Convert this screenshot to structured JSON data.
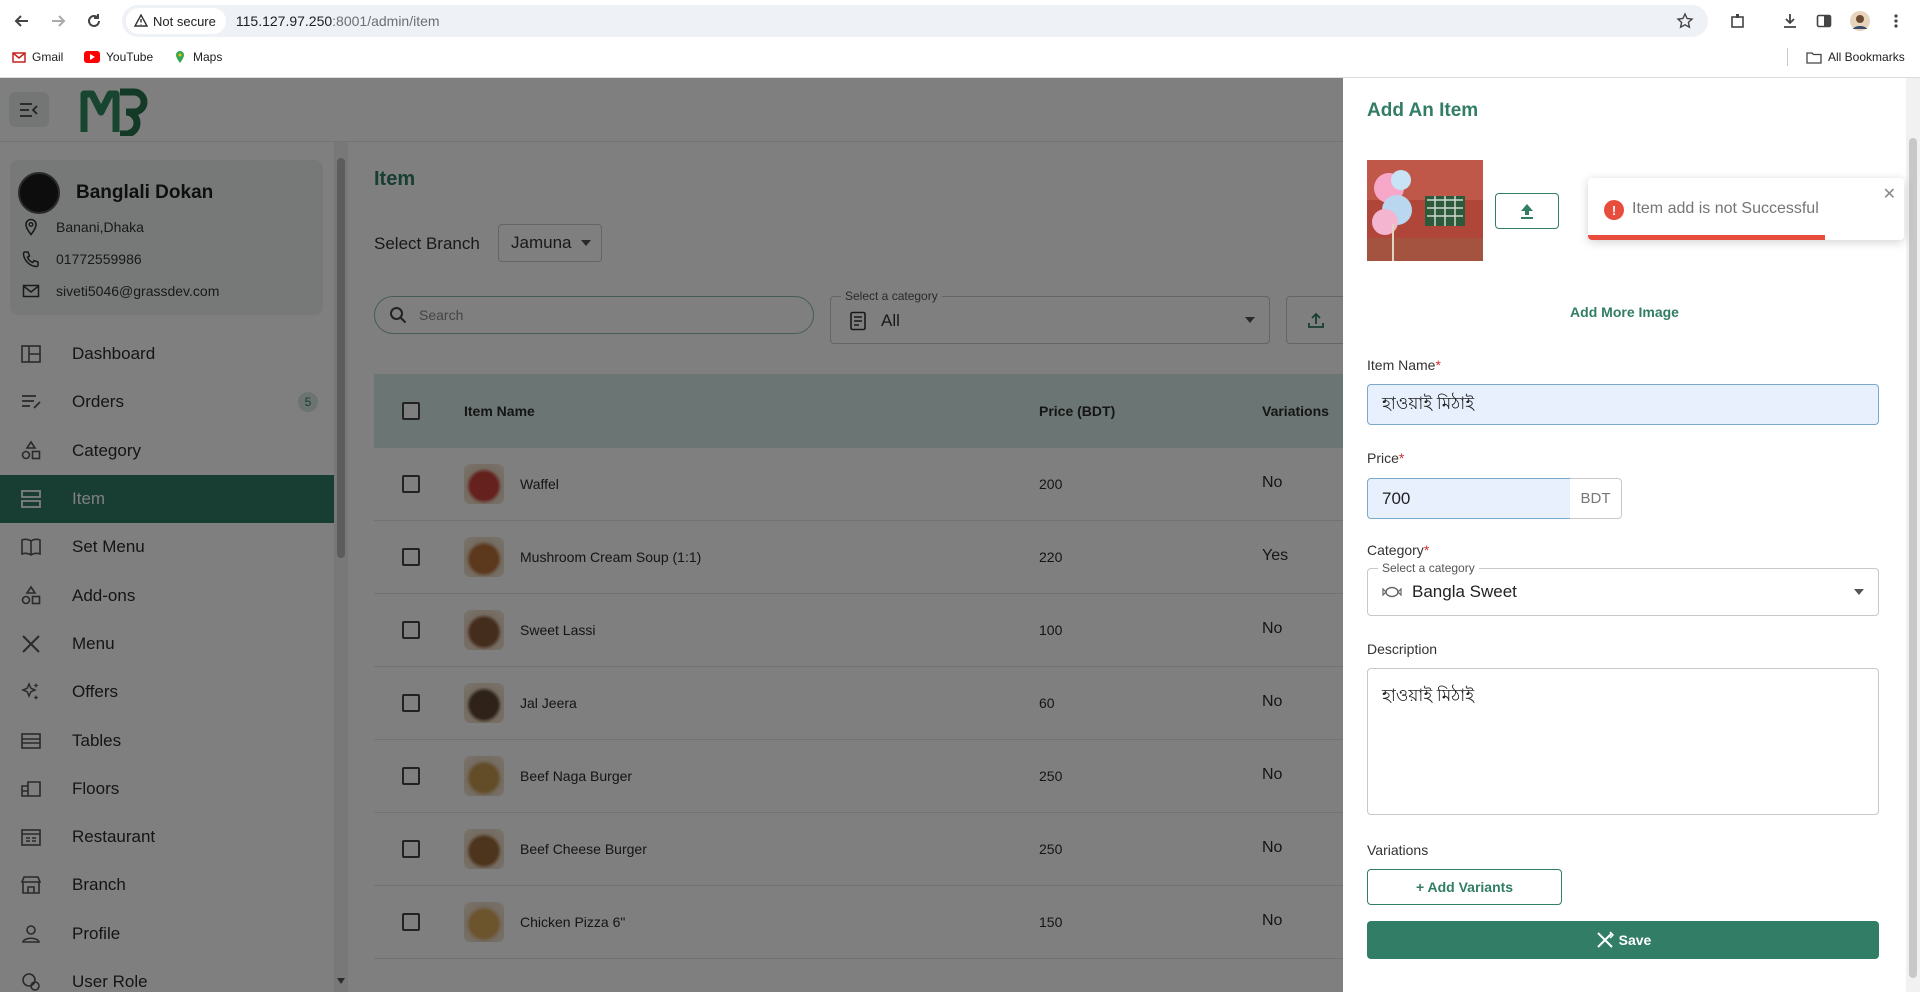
{
  "browser": {
    "security_label": "Not secure",
    "url_host": "115.127.97.250",
    "url_rest": ":8001/admin/item",
    "bookmarks": [
      "Gmail",
      "YouTube",
      "Maps"
    ],
    "all_bookmarks": "All Bookmarks"
  },
  "sidebar": {
    "shop_name": "Banglali Dokan",
    "address": "Banani,Dhaka",
    "phone": "01772559986",
    "email": "siveti5046@grassdev.com",
    "items": [
      {
        "label": "Dashboard",
        "icon": "dashboard-icon"
      },
      {
        "label": "Orders",
        "icon": "orders-icon",
        "badge": "5"
      },
      {
        "label": "Category",
        "icon": "category-icon"
      },
      {
        "label": "Item",
        "icon": "item-icon",
        "active": true
      },
      {
        "label": "Set Menu",
        "icon": "set-menu-icon"
      },
      {
        "label": "Add-ons",
        "icon": "add-ons-icon"
      },
      {
        "label": "Menu",
        "icon": "menu-icon"
      },
      {
        "label": "Offers",
        "icon": "offers-icon"
      },
      {
        "label": "Tables",
        "icon": "tables-icon"
      },
      {
        "label": "Floors",
        "icon": "floors-icon"
      },
      {
        "label": "Restaurant",
        "icon": "restaurant-icon"
      },
      {
        "label": "Branch",
        "icon": "branch-icon"
      },
      {
        "label": "Profile",
        "icon": "profile-icon"
      },
      {
        "label": "User Role",
        "icon": "user-role-icon"
      }
    ]
  },
  "main": {
    "title": "Item",
    "branch_label": "Select Branch",
    "branch_value": "Jamuna",
    "search_placeholder": "Search",
    "category_legend": "Select a category",
    "category_value": "All",
    "table": {
      "columns": [
        "Item Name",
        "Price (BDT)",
        "Variations"
      ],
      "rows": [
        {
          "name": "Waffel",
          "price": "200",
          "variations": "No",
          "thumb": "#c9423a"
        },
        {
          "name": "Mushroom Cream Soup (1:1)",
          "price": "220",
          "variations": "Yes",
          "thumb": "#b8713a"
        },
        {
          "name": "Sweet Lassi",
          "price": "100",
          "variations": "No",
          "thumb": "#8a5a3a"
        },
        {
          "name": "Jal Jeera",
          "price": "60",
          "variations": "No",
          "thumb": "#5e4632"
        },
        {
          "name": "Beef Naga Burger",
          "price": "250",
          "variations": "No",
          "thumb": "#c79a52"
        },
        {
          "name": "Beef Cheese Burger",
          "price": "250",
          "variations": "No",
          "thumb": "#9a6a3a"
        },
        {
          "name": "Chicken Pizza 6\"",
          "price": "150",
          "variations": "No",
          "thumb": "#d9a85a"
        }
      ]
    }
  },
  "drawer": {
    "title": "Add An Item",
    "add_more_image": "Add More Image",
    "item_name_label": "Item Name",
    "item_name_value": "হাওয়াই মিঠাই",
    "price_label": "Price",
    "price_value": "700",
    "price_unit": "BDT",
    "category_label": "Category",
    "category_legend": "Select a category",
    "category_value": "Bangla Sweet",
    "description_label": "Description",
    "description_value": "হাওয়াই মিঠাই",
    "variations_label": "Variations",
    "add_variants": "+ Add Variants",
    "save": "Save"
  },
  "toast": {
    "message": "Item add is not Successful",
    "progress": 0.75,
    "color": "#e74c3c"
  },
  "colors": {
    "primary": "#317d66",
    "table_header": "#d6ebe6",
    "error": "#e74c3c"
  }
}
